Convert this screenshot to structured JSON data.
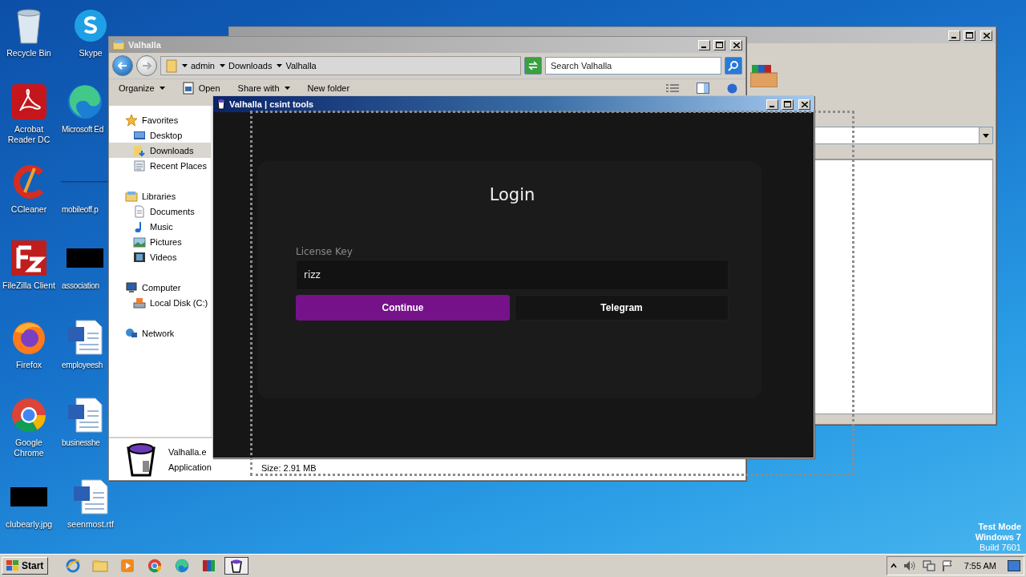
{
  "desktop_icons": [
    {
      "label": "Recycle Bin",
      "kind": "recycle"
    },
    {
      "label": "Skype",
      "kind": "skype"
    },
    {
      "label": "Acrobat Reader DC",
      "kind": "acrobat"
    },
    {
      "label": "Microsoft Ed",
      "kind": "edge"
    },
    {
      "label": "CCleaner",
      "kind": "ccleaner"
    },
    {
      "label": "mobileoff.p",
      "kind": "blank"
    },
    {
      "label": "FileZilla Client",
      "kind": "filezilla"
    },
    {
      "label": "association",
      "kind": "black"
    },
    {
      "label": "Firefox",
      "kind": "firefox"
    },
    {
      "label": "employeesh",
      "kind": "word"
    },
    {
      "label": "Google Chrome",
      "kind": "chrome"
    },
    {
      "label": "businesshe",
      "kind": "word"
    },
    {
      "label": "clubearly.jpg",
      "kind": "black"
    },
    {
      "label": "seenmost.rtf",
      "kind": "word"
    }
  ],
  "explorer": {
    "title": "Valhalla",
    "breadcrumbs": [
      "admin",
      "Downloads",
      "Valhalla"
    ],
    "search": {
      "placeholder": "Search Valhalla"
    },
    "toolbar": [
      {
        "label": "Organize",
        "kind": "menu"
      },
      {
        "label": "Open",
        "kind": "open"
      },
      {
        "label": "Share with",
        "kind": "menu"
      },
      {
        "label": "New folder",
        "kind": "plain"
      }
    ],
    "nav": [
      {
        "label": "Favorites",
        "kind": "star",
        "selected": false,
        "children": [
          {
            "label": "Desktop",
            "kind": "desktop",
            "selected": false
          },
          {
            "label": "Downloads",
            "kind": "downloads",
            "selected": true
          },
          {
            "label": "Recent Places",
            "kind": "recent",
            "selected": false
          }
        ]
      },
      {
        "label": "Libraries",
        "kind": "libraries",
        "selected": false,
        "children": [
          {
            "label": "Documents",
            "kind": "documents",
            "selected": false
          },
          {
            "label": "Music",
            "kind": "music",
            "selected": false
          },
          {
            "label": "Pictures",
            "kind": "pictures",
            "selected": false
          },
          {
            "label": "Videos",
            "kind": "videos",
            "selected": false
          }
        ]
      },
      {
        "label": "Computer",
        "kind": "computer",
        "selected": false,
        "children": [
          {
            "label": "Local Disk (C:)",
            "kind": "disk",
            "selected": false
          }
        ]
      },
      {
        "label": "Network",
        "kind": "network",
        "selected": false
      }
    ],
    "details": {
      "name": "Valhalla.e",
      "type": "Application",
      "size": "Size: 2.91 MB"
    }
  },
  "login_window": {
    "title": "Valhalla | csint tools",
    "heading": "Login",
    "field": {
      "label": "License Key",
      "value": "rizz"
    },
    "buttons": [
      {
        "label": "Continue",
        "kind": "primary"
      },
      {
        "label": "Telegram",
        "kind": "secondary"
      }
    ]
  },
  "system_notice": [
    "Test Mode",
    "Windows 7",
    "Build 7601"
  ],
  "taskbar": {
    "start": "Start",
    "apps": [
      {
        "kind": "ie",
        "selected": false
      },
      {
        "kind": "explorer",
        "selected": false
      },
      {
        "kind": "media",
        "selected": false
      },
      {
        "kind": "chrome",
        "selected": false
      },
      {
        "kind": "edge",
        "selected": false
      },
      {
        "kind": "winrar",
        "selected": false
      },
      {
        "kind": "valhalla",
        "selected": true
      }
    ],
    "clock": "7:55 AM"
  }
}
